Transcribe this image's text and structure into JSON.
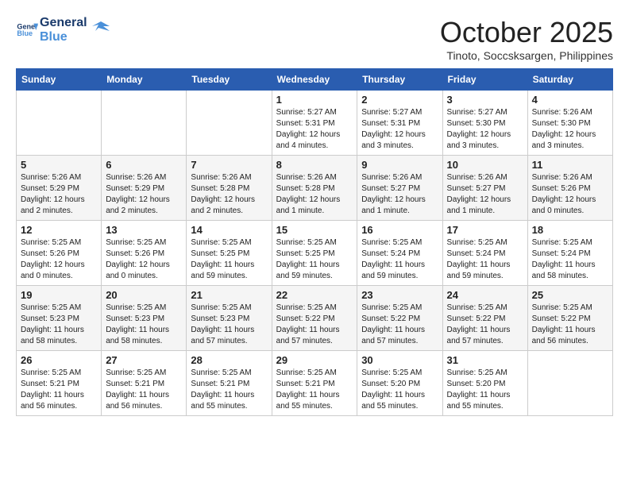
{
  "logo": {
    "line1": "General",
    "line2": "Blue"
  },
  "title": "October 2025",
  "location": "Tinoto, Soccsksargen, Philippines",
  "weekdays": [
    "Sunday",
    "Monday",
    "Tuesday",
    "Wednesday",
    "Thursday",
    "Friday",
    "Saturday"
  ],
  "weeks": [
    [
      {
        "day": "",
        "info": ""
      },
      {
        "day": "",
        "info": ""
      },
      {
        "day": "",
        "info": ""
      },
      {
        "day": "1",
        "info": "Sunrise: 5:27 AM\nSunset: 5:31 PM\nDaylight: 12 hours\nand 4 minutes."
      },
      {
        "day": "2",
        "info": "Sunrise: 5:27 AM\nSunset: 5:31 PM\nDaylight: 12 hours\nand 3 minutes."
      },
      {
        "day": "3",
        "info": "Sunrise: 5:27 AM\nSunset: 5:30 PM\nDaylight: 12 hours\nand 3 minutes."
      },
      {
        "day": "4",
        "info": "Sunrise: 5:26 AM\nSunset: 5:30 PM\nDaylight: 12 hours\nand 3 minutes."
      }
    ],
    [
      {
        "day": "5",
        "info": "Sunrise: 5:26 AM\nSunset: 5:29 PM\nDaylight: 12 hours\nand 2 minutes."
      },
      {
        "day": "6",
        "info": "Sunrise: 5:26 AM\nSunset: 5:29 PM\nDaylight: 12 hours\nand 2 minutes."
      },
      {
        "day": "7",
        "info": "Sunrise: 5:26 AM\nSunset: 5:28 PM\nDaylight: 12 hours\nand 2 minutes."
      },
      {
        "day": "8",
        "info": "Sunrise: 5:26 AM\nSunset: 5:28 PM\nDaylight: 12 hours\nand 1 minute."
      },
      {
        "day": "9",
        "info": "Sunrise: 5:26 AM\nSunset: 5:27 PM\nDaylight: 12 hours\nand 1 minute."
      },
      {
        "day": "10",
        "info": "Sunrise: 5:26 AM\nSunset: 5:27 PM\nDaylight: 12 hours\nand 1 minute."
      },
      {
        "day": "11",
        "info": "Sunrise: 5:26 AM\nSunset: 5:26 PM\nDaylight: 12 hours\nand 0 minutes."
      }
    ],
    [
      {
        "day": "12",
        "info": "Sunrise: 5:25 AM\nSunset: 5:26 PM\nDaylight: 12 hours\nand 0 minutes."
      },
      {
        "day": "13",
        "info": "Sunrise: 5:25 AM\nSunset: 5:26 PM\nDaylight: 12 hours\nand 0 minutes."
      },
      {
        "day": "14",
        "info": "Sunrise: 5:25 AM\nSunset: 5:25 PM\nDaylight: 11 hours\nand 59 minutes."
      },
      {
        "day": "15",
        "info": "Sunrise: 5:25 AM\nSunset: 5:25 PM\nDaylight: 11 hours\nand 59 minutes."
      },
      {
        "day": "16",
        "info": "Sunrise: 5:25 AM\nSunset: 5:24 PM\nDaylight: 11 hours\nand 59 minutes."
      },
      {
        "day": "17",
        "info": "Sunrise: 5:25 AM\nSunset: 5:24 PM\nDaylight: 11 hours\nand 59 minutes."
      },
      {
        "day": "18",
        "info": "Sunrise: 5:25 AM\nSunset: 5:24 PM\nDaylight: 11 hours\nand 58 minutes."
      }
    ],
    [
      {
        "day": "19",
        "info": "Sunrise: 5:25 AM\nSunset: 5:23 PM\nDaylight: 11 hours\nand 58 minutes."
      },
      {
        "day": "20",
        "info": "Sunrise: 5:25 AM\nSunset: 5:23 PM\nDaylight: 11 hours\nand 58 minutes."
      },
      {
        "day": "21",
        "info": "Sunrise: 5:25 AM\nSunset: 5:23 PM\nDaylight: 11 hours\nand 57 minutes."
      },
      {
        "day": "22",
        "info": "Sunrise: 5:25 AM\nSunset: 5:22 PM\nDaylight: 11 hours\nand 57 minutes."
      },
      {
        "day": "23",
        "info": "Sunrise: 5:25 AM\nSunset: 5:22 PM\nDaylight: 11 hours\nand 57 minutes."
      },
      {
        "day": "24",
        "info": "Sunrise: 5:25 AM\nSunset: 5:22 PM\nDaylight: 11 hours\nand 57 minutes."
      },
      {
        "day": "25",
        "info": "Sunrise: 5:25 AM\nSunset: 5:22 PM\nDaylight: 11 hours\nand 56 minutes."
      }
    ],
    [
      {
        "day": "26",
        "info": "Sunrise: 5:25 AM\nSunset: 5:21 PM\nDaylight: 11 hours\nand 56 minutes."
      },
      {
        "day": "27",
        "info": "Sunrise: 5:25 AM\nSunset: 5:21 PM\nDaylight: 11 hours\nand 56 minutes."
      },
      {
        "day": "28",
        "info": "Sunrise: 5:25 AM\nSunset: 5:21 PM\nDaylight: 11 hours\nand 55 minutes."
      },
      {
        "day": "29",
        "info": "Sunrise: 5:25 AM\nSunset: 5:21 PM\nDaylight: 11 hours\nand 55 minutes."
      },
      {
        "day": "30",
        "info": "Sunrise: 5:25 AM\nSunset: 5:20 PM\nDaylight: 11 hours\nand 55 minutes."
      },
      {
        "day": "31",
        "info": "Sunrise: 5:25 AM\nSunset: 5:20 PM\nDaylight: 11 hours\nand 55 minutes."
      },
      {
        "day": "",
        "info": ""
      }
    ]
  ]
}
